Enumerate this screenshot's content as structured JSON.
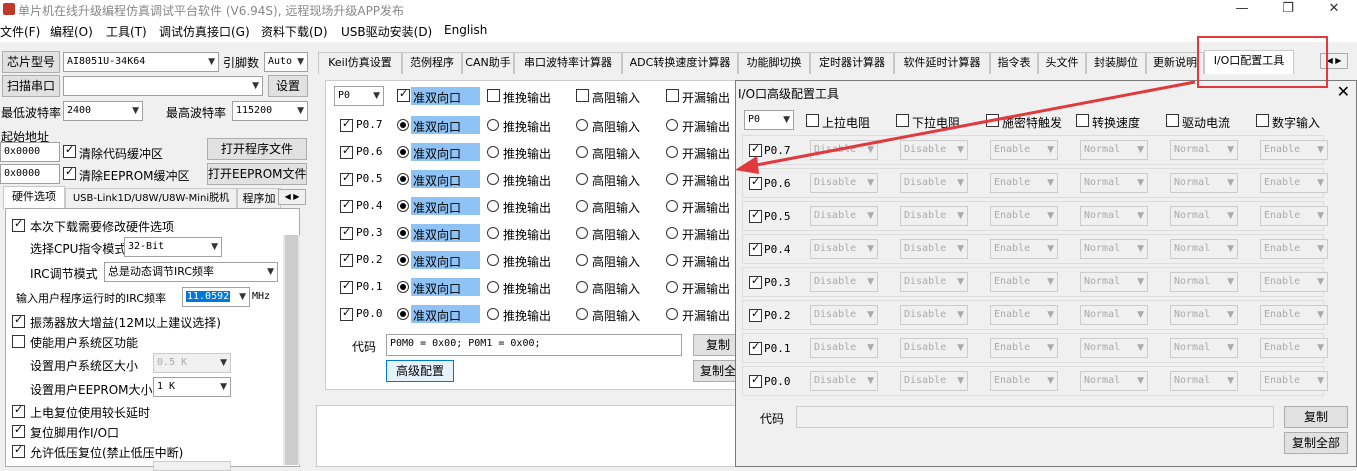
{
  "window": {
    "title": "单片机在线升级编程仿真调试平台软件 (V6.94S), 远程现场升级APP发布",
    "minimize": "—",
    "restore": "❐",
    "close": "✕"
  },
  "menu": [
    "文件(F)",
    "编程(O)",
    "工具(T)",
    "调试仿真接口(G)",
    "资料下载(D)",
    "USB驱动安装(D)",
    "English"
  ],
  "left": {
    "chip_type_label": "芯片型号",
    "chip_type_value": "AI8051U-34K64",
    "pin_label": "引脚数",
    "pin_value": "Auto",
    "scan_port_label": "扫描串口",
    "port_value": "",
    "settings_label": "设置",
    "min_baud_label": "最低波特率",
    "min_baud_value": "2400",
    "max_baud_label": "最高波特率",
    "max_baud_value": "115200",
    "start_addr_label": "起始地址",
    "addr1_value": "0x0000",
    "clear_code_label": "清除代码缓冲区",
    "open_program_label": "打开程序文件",
    "addr2_value": "0x0000",
    "clear_eeprom_label": "清除EEPROM缓冲区",
    "open_eeprom_label": "打开EEPROM文件",
    "tabs": [
      "硬件选项",
      "USB-Link1D/U8W/U8W-Mini脱机",
      "程序加"
    ],
    "hw": {
      "download_modify_label": "本次下载需要修改硬件选项",
      "cpu_mode_label": "选择CPU指令模式",
      "cpu_mode_value": "32-Bit",
      "irc_mode_label": "IRC调节模式",
      "irc_mode_value": "总是动态调节IRC频率",
      "irc_freq_label": "输入用户程序运行时的IRC频率",
      "irc_freq_value": "11.0592",
      "irc_unit": "MHz",
      "osc_gain_label": "振荡器放大增益(12M以上建议选择)",
      "sys_area_label": "使能用户系统区功能",
      "sys_size_label": "设置用户系统区大小",
      "sys_size_value": "0.5 K",
      "eeprom_size_label": "设置用户EEPROM大小",
      "eeprom_size_value": "1   K",
      "long_delay_label": "上电复位使用较长延时",
      "reset_io_label": "复位脚用作I/O口",
      "lvd_label": "允许低压复位(禁止低压中断)"
    }
  },
  "main_tabs": [
    "Keil仿真设置",
    "范例程序",
    "CAN助手",
    "串口波特率计算器",
    "ADC转换速度计算器",
    "功能脚切换",
    "定时器计算器",
    "软件延时计算器",
    "指令表",
    "头文件",
    "封装脚位",
    "更新说明",
    "I/O口配置工具"
  ],
  "io": {
    "port_value": "P0",
    "header_options": [
      "准双向口",
      "推挽输出",
      "高阻输入",
      "开漏输出"
    ],
    "pins": [
      "P0.7",
      "P0.6",
      "P0.5",
      "P0.4",
      "P0.3",
      "P0.2",
      "P0.1",
      "P0.0"
    ],
    "code_label": "代码",
    "code_value": "P0M0 = 0x00; P0M1 = 0x00;",
    "advanced_label": "高级配置",
    "copy_label": "复制",
    "copy_all_label": "复制全"
  },
  "dialog": {
    "title": "I/O口高级配置工具",
    "close": "✕",
    "port_value": "P0",
    "headers": [
      "上拉电阻",
      "下拉电阻",
      "施密特触发",
      "转换速度",
      "驱动电流",
      "数字输入"
    ],
    "pins": [
      "P0.7",
      "P0.6",
      "P0.5",
      "P0.4",
      "P0.3",
      "P0.2",
      "P0.1",
      "P0.0"
    ],
    "cells": [
      "Disable",
      "Disable",
      "Enable",
      "Normal",
      "Normal",
      "Enable"
    ],
    "code_label": "代码",
    "copy_label": "复制",
    "copy_all_label": "复制全部"
  },
  "colors": {
    "highlight": "#8fc3f5",
    "annotation_red": "#e0393e"
  }
}
